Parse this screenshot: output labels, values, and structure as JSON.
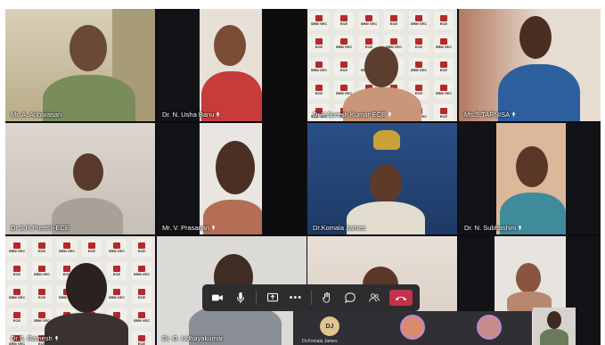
{
  "participants": [
    {
      "name": "Mr. A. Anbarasan",
      "muted": false
    },
    {
      "name": "Dr. N. Usha Banu",
      "muted": true
    },
    {
      "name": "Dr.V.Suresh Kumar-ECE",
      "muted": true
    },
    {
      "name": "Ms.S.TARNISA",
      "muted": true
    },
    {
      "name": "Dr.S.R.Preethi-ECE",
      "muted": false
    },
    {
      "name": "Mr. V. Prasanan",
      "muted": true
    },
    {
      "name": "Dr.Komala James",
      "muted": false
    },
    {
      "name": "Dr. N. Subhashini",
      "muted": true
    },
    {
      "name": "Dr.S. Ramesh",
      "muted": true
    },
    {
      "name": "Dr. G. Udhayakumar",
      "muted": false
    }
  ],
  "backgrounds": {
    "logo_top": "SRM VEC",
    "logo_bottom": "ECE",
    "logo_edge": "VEC"
  },
  "toolbar": {
    "buttons": [
      "camera",
      "microphone",
      "share-screen",
      "more",
      "raise-hand",
      "chat",
      "people",
      "leave"
    ],
    "more_glyph": "•••"
  },
  "gallery_strip": {
    "initials": "DJ",
    "name": "Dr.Komala James"
  },
  "colors": {
    "toolbar_bg": "#2d2d30",
    "leave_red": "#c4314b",
    "logo_red": "#b22a2a",
    "logo_bg": "#f1efe9"
  }
}
